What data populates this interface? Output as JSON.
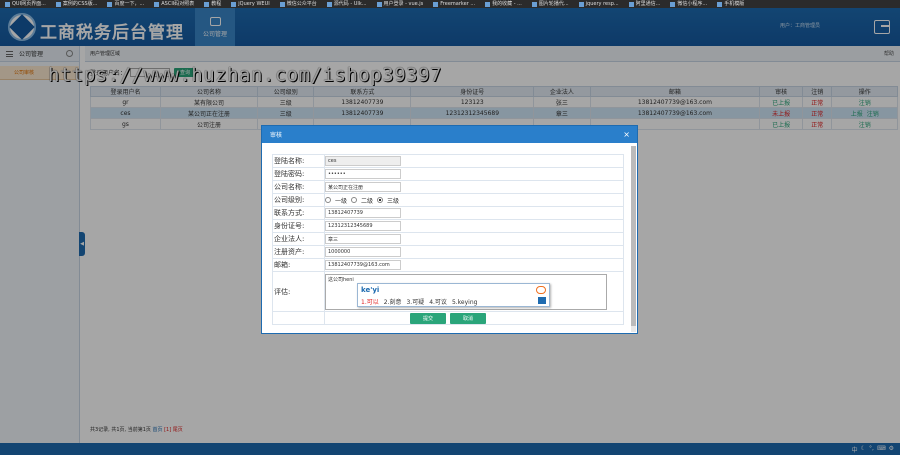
{
  "bookmarks": [
    {
      "label": "QUI网页界面..."
    },
    {
      "label": "案例的CSS版..."
    },
    {
      "label": "百度一下，..."
    },
    {
      "label": "ASCII码对照表"
    },
    {
      "label": "教程"
    },
    {
      "label": "jQuery WEUI"
    },
    {
      "label": "微信公众平台"
    },
    {
      "label": "源代码 - UIk..."
    },
    {
      "label": "用户登录 - vue.js"
    },
    {
      "label": "Freemarker ..."
    },
    {
      "label": "我的收藏 - ..."
    },
    {
      "label": "图片轮播代..."
    },
    {
      "label": "jquery resp..."
    },
    {
      "label": "阿里通信..."
    },
    {
      "label": "微信小程序..."
    },
    {
      "label": "手机模版"
    }
  ],
  "header": {
    "title": "工商税务后台管理",
    "tab_label": "公司管理",
    "user_info": "用户：工商管理员"
  },
  "sidebar": {
    "title": "公司管理",
    "items": [
      {
        "label": "公司审核"
      }
    ]
  },
  "panel": {
    "title": "用户管理区域",
    "help": "帮助",
    "search_label": "登录用户名：",
    "search_button": "查询"
  },
  "table": {
    "headers": [
      "登录用户名",
      "公司名称",
      "公司级别",
      "联系方式",
      "身份证号",
      "企业法人",
      "邮箱",
      "审核",
      "注销",
      "操作"
    ],
    "rows": [
      {
        "cells": [
          "gr",
          "某有限公司",
          "三级",
          "13812407739",
          "123123",
          "张三",
          "13812407739@163.com",
          "已上报",
          "正常",
          "注销"
        ],
        "status": "ok",
        "op_extra": ""
      },
      {
        "cells": [
          "ces",
          "某公司正在注册",
          "三级",
          "13812407739",
          "12312312345689",
          "章三",
          "13812407739@163.com",
          "未上报",
          "正常",
          "上报"
        ],
        "status": "bad",
        "op_extra": "注销"
      },
      {
        "cells": [
          "gs",
          "公司注册",
          "",
          "",
          "",
          "",
          "",
          "已上报",
          "正常",
          "注销"
        ],
        "status": "ok",
        "op_extra": ""
      }
    ]
  },
  "footer_info": {
    "prefix": "共3记录, 共1页, 当前第1页",
    "first": "首页",
    "page": "[1]",
    "last": "尾页"
  },
  "watermark": "https://www.huzhan.com/ishop39397",
  "modal": {
    "title": "审核",
    "close": "×",
    "fields": [
      {
        "label": "登陆名称:",
        "value": "ces",
        "readonly": true
      },
      {
        "label": "登陆密码:",
        "value": "••••••"
      },
      {
        "label": "公司名称:",
        "value": "某公司正在注册"
      },
      {
        "label": "公司级别:",
        "radio": true
      },
      {
        "label": "联系方式:",
        "value": "13812407739"
      },
      {
        "label": "身份证号:",
        "value": "12312312345689"
      },
      {
        "label": "企业法人:",
        "value": "章三"
      },
      {
        "label": "注册资产:",
        "value": "1000000"
      },
      {
        "label": "邮箱:",
        "value": "13812407739@163.com"
      }
    ],
    "radio_options": [
      "一级",
      "二级",
      "三级"
    ],
    "radio_selected": "三级",
    "comment_label": "评估:",
    "comment_value": "这公司heni",
    "ime_input": "ke'yi",
    "ime_candidates": [
      "1.可以",
      "2.刻意",
      "3.可疑",
      "4.可议",
      "5.keying"
    ],
    "submit": "提交",
    "cancel": "取消"
  }
}
